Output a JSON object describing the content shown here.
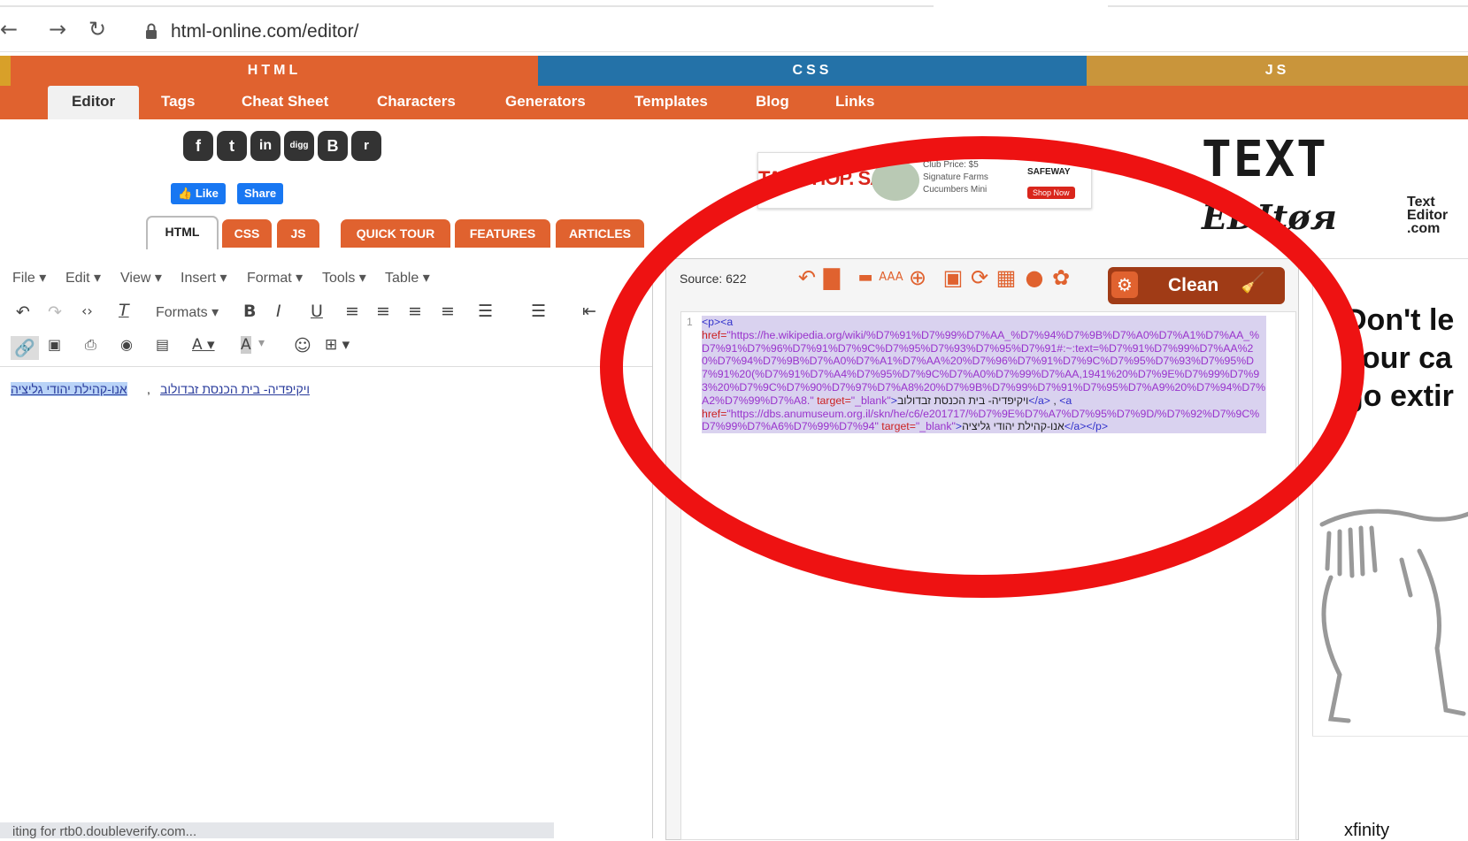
{
  "browser": {
    "url": "html-online.com/editor/"
  },
  "top_sections": [
    {
      "label": "HTML",
      "color": "#e0622f"
    },
    {
      "label": "CSS",
      "color": "#2472a8"
    },
    {
      "label": "JS",
      "color": "#c9953b"
    }
  ],
  "subnav": [
    "Editor",
    "Tags",
    "Cheat Sheet",
    "Characters",
    "Generators",
    "Templates",
    "Blog",
    "Links"
  ],
  "social": {
    "like": "Like",
    "share": "Share"
  },
  "pills": [
    "HTML",
    "CSS",
    "JS",
    "QUICK TOUR",
    "FEATURES",
    "ARTICLES"
  ],
  "ad": {
    "slogan": "TAP. SHOP. SAVE.",
    "line1": "Club Price: $5",
    "line2": "Signature Farms",
    "line3": "Cucumbers Mini",
    "brand": "SAFEWAY",
    "cta": "Shop Now"
  },
  "logo": {
    "line1": "TEXT",
    "line2": "EDItøя",
    "side": [
      "Text",
      "Editor",
      ".com"
    ]
  },
  "menu": [
    "File",
    "Edit",
    "View",
    "Insert",
    "Format",
    "Tools",
    "Table"
  ],
  "toolbar": {
    "formats": "Formats"
  },
  "editor": {
    "link1": "ויקיפדיה- בית הכנסת זבדולוב",
    "sep": " , ",
    "link2": "אנו-קהילת יהודי גליציה"
  },
  "status_text": "iting for rtb0.doubleverify.com...",
  "source": {
    "label": "Source: 622",
    "clean": "Clean",
    "line_no": "1",
    "code": {
      "p_open": "<p><a",
      "href1_attr": "href=",
      "href1_val": "\"https://he.wikipedia.org/wiki/%D7%91%D7%99%D7%AA_%D7%94%D7%9B%D7%A0%D7%A1%D7%AA_%D7%91%D7%96%D7%91%D7%9C%D7%95%D7%93%D7%95%D7%91#:~:text=%D7%91%D7%99%D7%AA%20%D7%94%D7%9B%D7%A0%D7%A1%D7%AA%20%D7%96%D7%91%D7%9C%D7%95%D7%93%D7%95%D7%91%20(%D7%91%D7%A4%D7%95%D7%9C%D7%A0%D7%99%D7%AA,1941%20%D7%9E%D7%99%D7%93%20%D7%9C%D7%90%D7%97%D7%A8%20%D7%9B%D7%99%D7%91%D7%95%D7%A9%20%D7%94%D7%A2%D7%99%D7%A8.\"",
      "target1_attr": "target=",
      "target1_val": "\"_blank\"",
      "tag_close1": ">",
      "text1": "ויקיפדיה- בית הכנסת זבדולוב",
      "a_close1": "</a>",
      "between": " , ",
      "a_open2": "<a",
      "href2_attr": "href=",
      "href2_val": "\"https://dbs.anumuseum.org.il/skn/he/c6/e201717/%D7%9E%D7%A7%D7%95%D7%9D/%D7%92%D7%9C%D7%99%D7%A6%D7%99%D7%94\"",
      "target2_attr": "target=",
      "target2_val": "\"_blank\"",
      "tag_close2": ">",
      "text2": "אנו-קהילת יהודי גליציה",
      "a_close2": "</a></p>"
    }
  },
  "right_ad": {
    "headline1": "Don't le",
    "headline2": "your ca",
    "headline3": "go extir",
    "brand": "xfinity"
  },
  "annotation_color": "#ee1212"
}
